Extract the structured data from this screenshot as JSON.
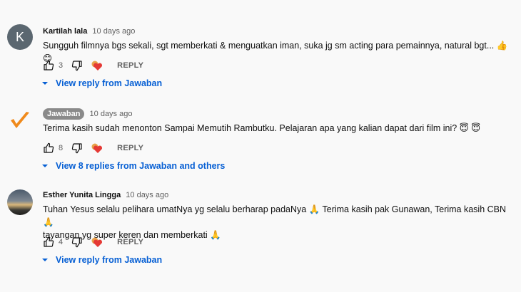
{
  "comments": [
    {
      "avatar_letter": "K",
      "author": "Kartilah lala",
      "time": "10 days ago",
      "text": "Sungguh filmnya bgs sekali, sgt memberkati & menguatkan iman, suka jg sm acting para pemainnya, natural bgt... 👍 😊",
      "likes": "3",
      "reply_label": "REPLY",
      "view_replies": "View reply from Jawaban"
    },
    {
      "author": "Jawaban",
      "time": "10 days ago",
      "text": "Terima kasih sudah menonton Sampai Memutih Rambutku. Pelajaran apa yang kalian dapat dari film ini? 😇 😇",
      "likes": "8",
      "reply_label": "REPLY",
      "view_replies": "View 8 replies from Jawaban and others"
    },
    {
      "author": "Esther Yunita Lingga",
      "time": "10 days ago",
      "text_line1": "Tuhan Yesus selalu pelihara umatNya yg selalu berharap padaNya 🙏  Terima kasih  pak Gunawan, Terima kasih CBN 🙏",
      "text_line2": "tayangan yg super keren dan memberkati 🙏",
      "likes": "4",
      "reply_label": "REPLY",
      "view_replies": "View reply from Jawaban"
    }
  ],
  "colors": {
    "link": "#065fd4",
    "secondary_text": "#606060",
    "heart": "#e53935",
    "background": "#f9f9f9"
  },
  "icons": [
    "thumb-up-icon",
    "thumb-down-icon",
    "creator-heart-icon",
    "caret-down-icon"
  ]
}
